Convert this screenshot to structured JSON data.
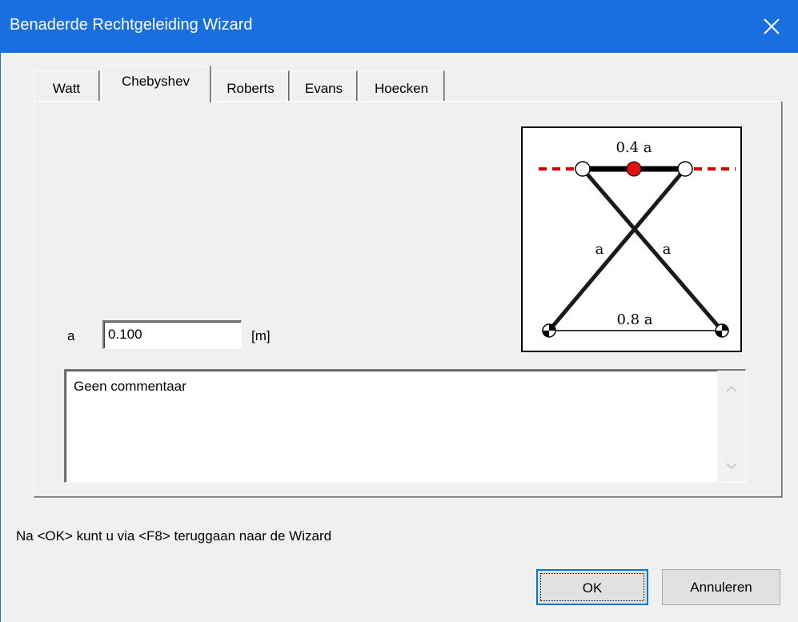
{
  "window": {
    "title": "Benaderde Rechtgeleiding Wizard",
    "close_symbol": "✕",
    "accent_color": "#1a6fe0"
  },
  "tabs": [
    {
      "label": "Watt",
      "active": false
    },
    {
      "label": "Chebyshev",
      "active": true
    },
    {
      "label": "Roberts",
      "active": false
    },
    {
      "label": "Evans",
      "active": false
    },
    {
      "label": "Hoecken",
      "active": false
    }
  ],
  "diagram": {
    "label_top": "0.4 a",
    "label_left": "a",
    "label_right": "a",
    "label_bottom": "0.8 a",
    "link_color": "#1a1a1a",
    "path_color": "#cc0000",
    "tracer_color": "#dd1111"
  },
  "parameter": {
    "label": "a",
    "value": "0.100",
    "unit": "[m]"
  },
  "comment": {
    "text": "Geen commentaar"
  },
  "hint": "Na <OK> kunt u via <F8> teruggaan naar de Wizard",
  "buttons": {
    "ok": "OK",
    "cancel": "Annuleren"
  }
}
